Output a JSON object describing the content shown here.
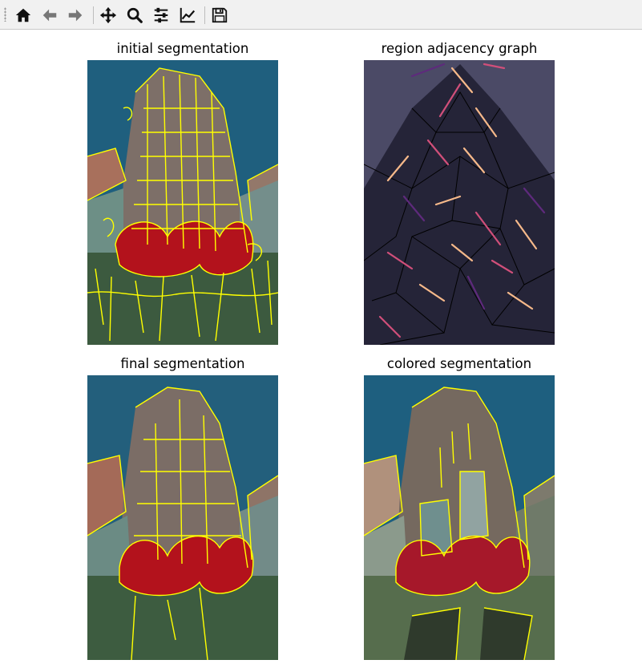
{
  "toolbar": {
    "buttons": [
      {
        "name": "home-button",
        "icon": "home-icon"
      },
      {
        "name": "back-button",
        "icon": "arrow-left-icon"
      },
      {
        "name": "forward-button",
        "icon": "arrow-right-icon"
      },
      {
        "name": "pan-button",
        "icon": "move-arrows-icon"
      },
      {
        "name": "zoom-button",
        "icon": "magnifier-icon"
      },
      {
        "name": "configure-subplots-button",
        "icon": "sliders-icon"
      },
      {
        "name": "edit-axis-button",
        "icon": "line-chart-icon"
      },
      {
        "name": "save-button",
        "icon": "floppy-disk-icon"
      }
    ]
  },
  "panels": [
    {
      "title": "initial segmentation"
    },
    {
      "title": "region adjacency graph"
    },
    {
      "title": "final segmentation"
    },
    {
      "title": "colored segmentation"
    }
  ],
  "colors": {
    "boundary": "#ffff00",
    "sky": "#1f5f7e",
    "tulip": "#b3121c",
    "graph_bg": "#4b4a66",
    "graph_edge_hot": "#f6b98a",
    "graph_edge_mid": "#d14f7a",
    "graph_edge_cool": "#5e2a7c"
  }
}
